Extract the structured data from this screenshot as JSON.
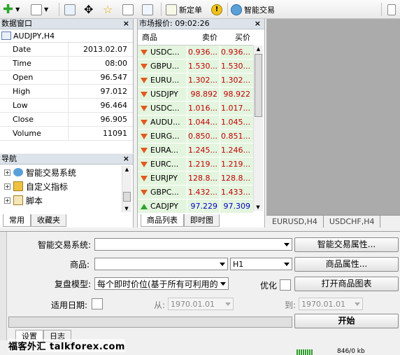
{
  "toolbar": {
    "new_order": "新定单",
    "expert_trading": "智能交易"
  },
  "data_window": {
    "title": "数据窗口",
    "symbol": "AUDJPY,H4",
    "rows": [
      {
        "key": "Date",
        "value": "2013.02.07"
      },
      {
        "key": "Time",
        "value": "08:00"
      },
      {
        "key": "Open",
        "value": "96.547"
      },
      {
        "key": "High",
        "value": "97.012"
      },
      {
        "key": "Low",
        "value": "96.464"
      },
      {
        "key": "Close",
        "value": "96.905"
      },
      {
        "key": "Volume",
        "value": "11091"
      }
    ]
  },
  "navigator": {
    "title": "导航",
    "items": [
      "智能交易系统",
      "自定义指标",
      "脚本"
    ],
    "tabs": [
      "常用",
      "收藏夹"
    ]
  },
  "market_watch": {
    "title": "市场报价: 09:02:26",
    "columns": {
      "symbol": "商品",
      "bid": "卖价",
      "ask": "买价"
    },
    "rows": [
      {
        "symbol": "USDC...",
        "bid": "0.936...",
        "ask": "0.936...",
        "dir": "down"
      },
      {
        "symbol": "GBPU...",
        "bid": "1.530...",
        "ask": "1.530...",
        "dir": "down"
      },
      {
        "symbol": "EURU...",
        "bid": "1.302...",
        "ask": "1.302...",
        "dir": "down"
      },
      {
        "symbol": "USDJPY",
        "bid": "98.892",
        "ask": "98.922",
        "dir": "down"
      },
      {
        "symbol": "USDC...",
        "bid": "1.016...",
        "ask": "1.017...",
        "dir": "down"
      },
      {
        "symbol": "AUDU...",
        "bid": "1.044...",
        "ask": "1.045...",
        "dir": "down"
      },
      {
        "symbol": "EURG...",
        "bid": "0.850...",
        "ask": "0.851...",
        "dir": "down"
      },
      {
        "symbol": "EURA...",
        "bid": "1.245...",
        "ask": "1.246...",
        "dir": "down"
      },
      {
        "symbol": "EURC...",
        "bid": "1.219...",
        "ask": "1.219...",
        "dir": "down"
      },
      {
        "symbol": "EURJPY",
        "bid": "128.8...",
        "ask": "128.8...",
        "dir": "down"
      },
      {
        "symbol": "GBPC...",
        "bid": "1.432...",
        "ask": "1.433...",
        "dir": "down"
      },
      {
        "symbol": "CADJPY",
        "bid": "97.229",
        "ask": "97.309",
        "dir": "up"
      }
    ],
    "tabs": [
      "商品列表",
      "即时图"
    ]
  },
  "chart_tabs": [
    "EURUSD,H4",
    "USDCHF,H4"
  ],
  "tester": {
    "ea_label": "智能交易系统:",
    "ea_props_button": "智能交易属性...",
    "symbol_label": "商品:",
    "period_value": "H1",
    "symbol_props_button": "商品属性...",
    "model_label": "复盘模型:",
    "model_value": "每个即时价位(基于所有可利用的",
    "optimize_label": "优化",
    "open_chart_button": "打开商品图表",
    "date_label": "适用日期:",
    "from_label": "从:",
    "from_value": "1970.01.01",
    "to_label": "到:",
    "to_value": "1970.01.01",
    "start_button": "开始",
    "tabs": [
      "设置",
      "日志"
    ]
  },
  "watermark": "福客外汇 talkforex.com",
  "status": "846/0 kb",
  "colors": {
    "bid_down": "#c00000",
    "bid_up": "#0000c0",
    "row_bg": "#e4f5df"
  }
}
